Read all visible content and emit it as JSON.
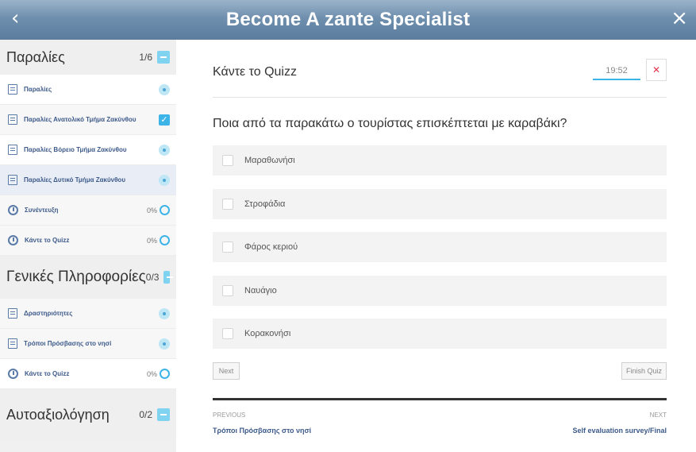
{
  "header": {
    "title": "Become A zante Specialist",
    "back_glyph": "‹",
    "close_glyph": "×"
  },
  "sidebar": {
    "sections": [
      {
        "title": "Παραλίες",
        "count": "1/6",
        "items": [
          {
            "label": "Παραλίες",
            "type": "lesson",
            "status": "view"
          },
          {
            "label": "Παραλίες Ανατολικό Τμήμα Ζακύνθου",
            "type": "lesson",
            "status": "done"
          },
          {
            "label": "Παραλίες Βόρειο Τμήμα Ζακύνθου",
            "type": "lesson",
            "status": "view"
          },
          {
            "label": "Παραλίες Δυτικό Τμήμα Ζακύνθου",
            "type": "lesson",
            "status": "view"
          },
          {
            "label": "Συνέντευξη",
            "type": "quiz",
            "percent": "0%"
          },
          {
            "label": "Κάντε το Quizz",
            "type": "quiz",
            "percent": "0%"
          }
        ]
      },
      {
        "title": "Γενικές Πληροφορίες",
        "count": "0/3",
        "items": [
          {
            "label": "Δραστηριότητες",
            "type": "lesson",
            "status": "view"
          },
          {
            "label": "Τρόποι Πρόσβασης στο νησί",
            "type": "lesson",
            "status": "view"
          },
          {
            "label": "Κάντε το Quizz",
            "type": "quiz",
            "percent": "0%"
          }
        ]
      },
      {
        "title": "Αυτοαξιολόγηση",
        "count": "0/2",
        "items": []
      }
    ]
  },
  "main": {
    "quiz_title": "Κάντε το Quizz",
    "timer": "19:52",
    "question": "Ποια από τα παρακάτω ο τουρίστας επισκέπτεται με καραβάκι?",
    "options": [
      "Μαραθωνήσι",
      "Στροφάδια",
      "Φάρος κεριού",
      "Ναυάγιο",
      "Κορακονήσι"
    ],
    "next_label": "Next",
    "finish_label": "Finish Quiz",
    "previous_caption": "PREVIOUS",
    "previous_link": "Τρόποι Πρόσβασης στο νησί",
    "next_caption": "NEXT",
    "next_link": "Self evaluation survey/Final"
  },
  "colors": {
    "accent": "#3db4e8",
    "link": "#3d5a8a",
    "close_red": "#e0334a"
  }
}
